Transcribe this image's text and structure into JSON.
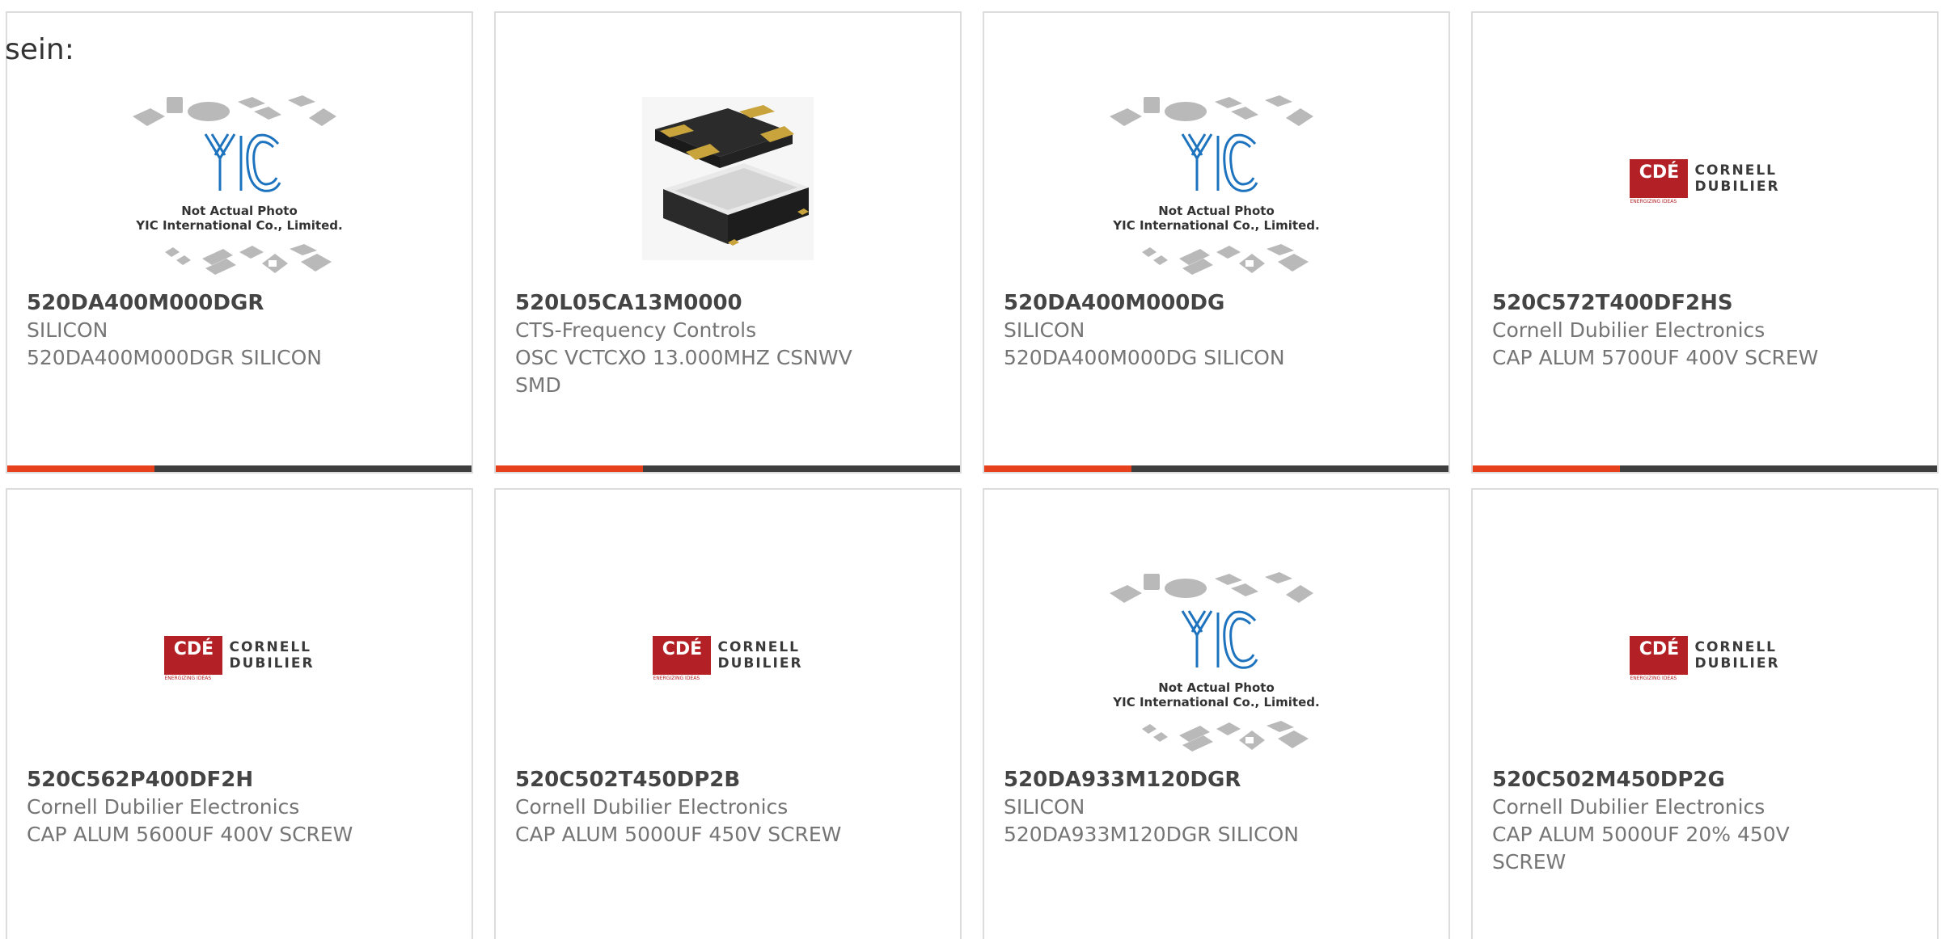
{
  "lead_text": "sein:",
  "accent_color": "#e6401c",
  "bar_color": "#3e3e3e",
  "products": [
    {
      "part_number": "520DA400M000DGR",
      "manufacturer": "SILICON",
      "description": "520DA400M000DGR SILICON",
      "image": "yic-placeholder",
      "image_caption_1": "Not Actual Photo",
      "image_caption_2": "YIC International Co., Limited."
    },
    {
      "part_number": "520L05CA13M0000",
      "manufacturer": "CTS-Frequency Controls",
      "description": "OSC VCTCXO 13.000MHZ CSNWV SMD",
      "image": "oscillator-photo"
    },
    {
      "part_number": "520DA400M000DG",
      "manufacturer": "SILICON",
      "description": "520DA400M000DG SILICON",
      "image": "yic-placeholder",
      "image_caption_1": "Not Actual Photo",
      "image_caption_2": "YIC International Co., Limited."
    },
    {
      "part_number": "520C572T400DF2HS",
      "manufacturer": "Cornell Dubilier Electronics",
      "description": "CAP ALUM 5700UF 400V SCREW",
      "image": "cde-logo"
    },
    {
      "part_number": "520C562P400DF2H",
      "manufacturer": "Cornell Dubilier Electronics",
      "description": "CAP ALUM 5600UF 400V SCREW",
      "image": "cde-logo"
    },
    {
      "part_number": "520C502T450DP2B",
      "manufacturer": "Cornell Dubilier Electronics",
      "description": "CAP ALUM 5000UF 450V SCREW",
      "image": "cde-logo"
    },
    {
      "part_number": "520DA933M120DGR",
      "manufacturer": "SILICON",
      "description": "520DA933M120DGR SILICON",
      "image": "yic-placeholder",
      "image_caption_1": "Not Actual Photo",
      "image_caption_2": "YIC International Co., Limited."
    },
    {
      "part_number": "520C502M450DP2G",
      "manufacturer": "Cornell Dubilier Electronics",
      "description": "CAP ALUM 5000UF 20% 450V SCREW",
      "image": "cde-logo"
    }
  ]
}
